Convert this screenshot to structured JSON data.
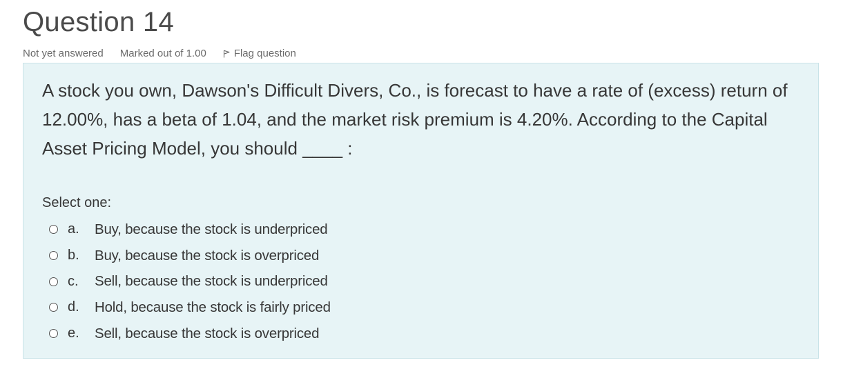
{
  "question": {
    "title": "Question 14",
    "state": "Not yet answered",
    "grade": "Marked out of 1.00",
    "flag_label": "Flag question",
    "text": "A stock you own, Dawson's Difficult Divers, Co., is forecast to have a rate of (excess) return of 12.00%, has a beta of 1.04, and the market risk premium is 4.20%. According to the Capital Asset Pricing Model, you should ____ :",
    "prompt": "Select one:",
    "options": [
      {
        "letter": "a.",
        "text": "Buy, because the stock is underpriced"
      },
      {
        "letter": "b.",
        "text": "Buy, because the stock is overpriced"
      },
      {
        "letter": "c.",
        "text": "Sell, because the stock is underpriced"
      },
      {
        "letter": "d.",
        "text": "Hold, because the stock is fairly priced"
      },
      {
        "letter": "e.",
        "text": "Sell, because the stock is overpriced"
      }
    ]
  },
  "icons": {
    "flag": "flag-icon",
    "radio": "radio-unchecked-icon"
  },
  "colors": {
    "panel_background": "#e7f4f6",
    "panel_border": "#c9e3e8",
    "text": "#373737",
    "muted_text": "#6a6a6a"
  }
}
